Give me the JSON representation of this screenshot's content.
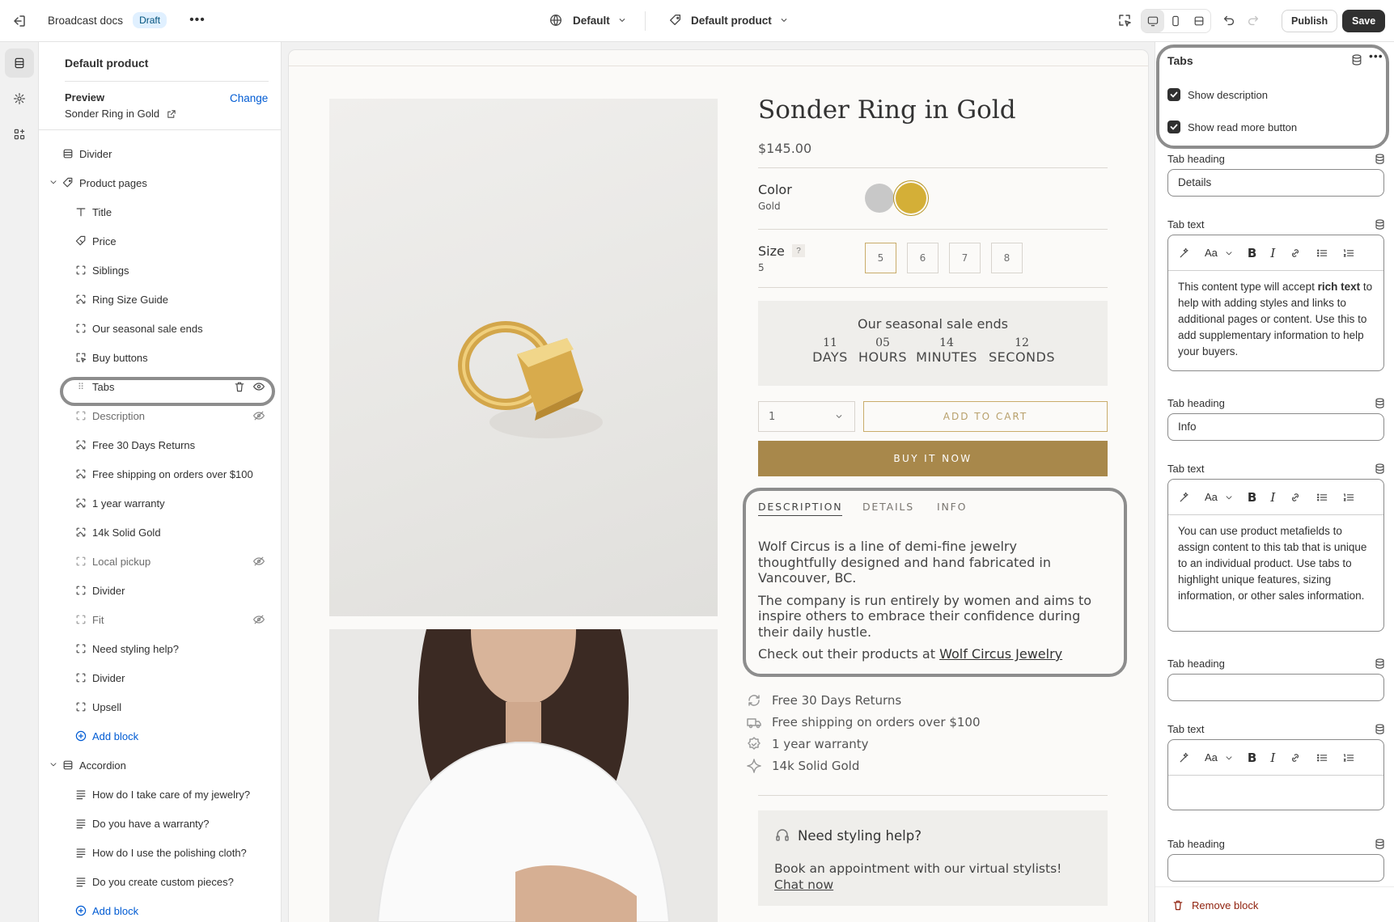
{
  "topbar": {
    "title": "Broadcast docs",
    "badge": "Draft",
    "theme_select": "Default",
    "template_select": "Default product",
    "publish_label": "Publish",
    "save_label": "Save"
  },
  "left_panel": {
    "title": "Default product",
    "preview_label": "Preview",
    "change_label": "Change",
    "preview_product": "Sonder Ring in Gold",
    "items": [
      {
        "label": "Divider",
        "icon": "section-icon"
      },
      {
        "label": "Product pages",
        "icon": "tag-icon"
      },
      {
        "label": "Title",
        "icon": "text-icon"
      },
      {
        "label": "Price",
        "icon": "price-tag-icon"
      },
      {
        "label": "Siblings",
        "icon": "block-icon"
      },
      {
        "label": "Ring Size Guide",
        "icon": "image-block-icon"
      },
      {
        "label": "Our seasonal sale ends",
        "icon": "block-icon"
      },
      {
        "label": "Buy buttons",
        "icon": "cursor-icon"
      },
      {
        "label": "Tabs",
        "icon": "drag-handle-icon"
      },
      {
        "label": "Description",
        "icon": "block-icon"
      },
      {
        "label": "Free 30 Days Returns",
        "icon": "image-block-icon"
      },
      {
        "label": "Free shipping on orders over $100",
        "icon": "image-block-icon"
      },
      {
        "label": "1 year warranty",
        "icon": "image-block-icon"
      },
      {
        "label": "14k Solid Gold",
        "icon": "image-block-icon"
      },
      {
        "label": "Local pickup",
        "icon": "block-icon"
      },
      {
        "label": "Divider",
        "icon": "block-icon"
      },
      {
        "label": "Fit",
        "icon": "block-icon"
      },
      {
        "label": "Need styling help?",
        "icon": "block-icon"
      },
      {
        "label": "Divider",
        "icon": "block-icon"
      },
      {
        "label": "Upsell",
        "icon": "block-icon"
      },
      {
        "label": "Add block",
        "icon": "plus-circle-icon"
      },
      {
        "label": "Accordion",
        "icon": "section-icon"
      },
      {
        "label": "How do I take care of my jewelry?",
        "icon": "lines-icon"
      },
      {
        "label": "Do you have a warranty?",
        "icon": "lines-icon"
      },
      {
        "label": "How do I use the polishing cloth?",
        "icon": "lines-icon"
      },
      {
        "label": "Do you create custom pieces?",
        "icon": "lines-icon"
      },
      {
        "label": "Add block",
        "icon": "plus-circle-icon"
      }
    ]
  },
  "preview": {
    "product_title": "Sonder Ring in Gold",
    "price": "$145.00",
    "color_label": "Color",
    "color_value": "Gold",
    "swatch_colors": [
      "#c8c8c8",
      "#d4af37"
    ],
    "size_label": "Size",
    "size_help": "?",
    "size_value": "5",
    "sizes": [
      "5",
      "6",
      "7",
      "8"
    ],
    "sale_title": "Our seasonal sale ends",
    "countdown": [
      {
        "num": "11",
        "unit": "DAYS"
      },
      {
        "num": "05",
        "unit": "HOURS"
      },
      {
        "num": "14",
        "unit": "MINUTES"
      },
      {
        "num": "12",
        "unit": "SECONDS"
      }
    ],
    "quantity": "1",
    "add_to_cart": "ADD TO CART",
    "buy_now": "BUY IT NOW",
    "tabs": [
      "DESCRIPTION",
      "DETAILS",
      "INFO"
    ],
    "desc_p1": "Wolf Circus is a line of demi-fine jewelry thoughtfully designed and hand fabricated in Vancouver, BC.",
    "desc_p2": "The company is run entirely by women and aims to inspire others to embrace their confidence during their daily hustle.",
    "desc_p3_prefix": "Check out their products at ",
    "desc_p3_link": "Wolf Circus Jewelry",
    "features": [
      "Free 30 Days Returns",
      "Free shipping on orders over $100",
      "1 year warranty",
      "14k Solid Gold"
    ],
    "styling_title": "Need styling help?",
    "styling_text": "Book an appointment with our virtual stylists!",
    "styling_link": "Chat now"
  },
  "right_panel": {
    "title": "Tabs",
    "show_description": "Show description",
    "show_read_more": "Show read more button",
    "tab_heading_label": "Tab heading",
    "tab_text_label": "Tab text",
    "tab1_heading": "Details",
    "tab1_text_a": "This content type will accept ",
    "tab1_text_bold": "rich text",
    "tab1_text_b": " to help with adding styles and links to additional pages or content. Use this to add supplementary information to help your buyers.",
    "tab2_heading": "Info",
    "tab2_text": "You can use product metafields to assign content to this tab that is unique to an individual product. Use tabs to highlight unique features, sizing information, or other sales information.",
    "tab3_heading": "",
    "remove_block": "Remove block",
    "accent_remove": "#8e1f0b"
  }
}
